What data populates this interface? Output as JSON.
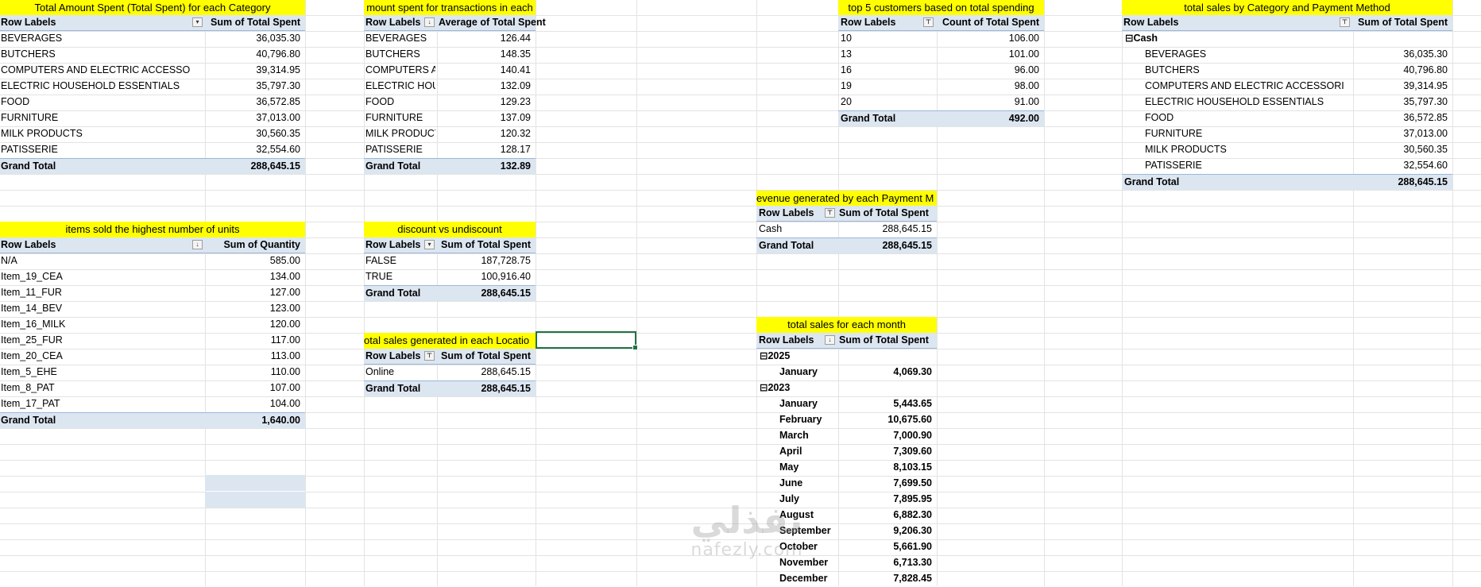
{
  "pivots": {
    "category": {
      "title": "Total Amount Spent (Total Spent) for each Category",
      "header": [
        "Row Labels",
        "Sum of Total Spent"
      ],
      "rows": [
        [
          "BEVERAGES",
          "36,035.30"
        ],
        [
          "BUTCHERS",
          "40,796.80"
        ],
        [
          "COMPUTERS AND ELECTRIC ACCESSORIES",
          "39,314.95"
        ],
        [
          "ELECTRIC HOUSEHOLD ESSENTIALS",
          "35,797.30"
        ],
        [
          "FOOD",
          "36,572.85"
        ],
        [
          "FURNITURE",
          "37,013.00"
        ],
        [
          "MILK PRODUCTS",
          "30,560.35"
        ],
        [
          "PATISSERIE",
          "32,554.60"
        ]
      ],
      "total": [
        "Grand Total",
        "288,645.15"
      ]
    },
    "average": {
      "title": "mount spent for transactions in each",
      "header": [
        "Row Labels",
        "Average of Total Spent"
      ],
      "rows": [
        [
          "BEVERAGES",
          "126.44"
        ],
        [
          "BUTCHERS",
          "148.35"
        ],
        [
          "COMPUTERS AND ELECTRIC ACCESSORIES",
          "140.41"
        ],
        [
          "ELECTRIC HOUSEHOLD ESSENTIALS",
          "132.09"
        ],
        [
          "FOOD",
          "129.23"
        ],
        [
          "FURNITURE",
          "137.09"
        ],
        [
          "MILK PRODUCTS",
          "120.32"
        ],
        [
          "PATISSERIE",
          "128.17"
        ]
      ],
      "total": [
        "Grand Total",
        "132.89"
      ]
    },
    "customers": {
      "title": "top 5 customers based on total spending",
      "header": [
        "Row Labels",
        "Count of Total Spent"
      ],
      "rows": [
        [
          "10",
          "106.00"
        ],
        [
          "13",
          "101.00"
        ],
        [
          "16",
          "96.00"
        ],
        [
          "19",
          "98.00"
        ],
        [
          "20",
          "91.00"
        ]
      ],
      "total": [
        "Grand Total",
        "492.00"
      ]
    },
    "category_payment": {
      "title": "total sales by Category and Payment Method",
      "header": [
        "Row Labels",
        "Sum of Total Spent"
      ],
      "group": "Cash",
      "rows": [
        [
          "BEVERAGES",
          "36,035.30"
        ],
        [
          "BUTCHERS",
          "40,796.80"
        ],
        [
          "COMPUTERS AND ELECTRIC ACCESSORIES",
          "39,314.95"
        ],
        [
          "ELECTRIC HOUSEHOLD ESSENTIALS",
          "35,797.30"
        ],
        [
          "FOOD",
          "36,572.85"
        ],
        [
          "FURNITURE",
          "37,013.00"
        ],
        [
          "MILK PRODUCTS",
          "30,560.35"
        ],
        [
          "PATISSERIE",
          "32,554.60"
        ]
      ],
      "total": [
        "Grand Total",
        "288,645.15"
      ]
    },
    "payment": {
      "title": "evenue generated by each Payment M",
      "header": [
        "Row Labels",
        "Sum of Total Spent"
      ],
      "rows": [
        [
          "Cash",
          "288,645.15"
        ]
      ],
      "total": [
        "Grand Total",
        "288,645.15"
      ]
    },
    "items": {
      "title": "items sold the highest number of units",
      "header": [
        "Row Labels",
        "Sum of Quantity"
      ],
      "rows": [
        [
          "N/A",
          "585.00"
        ],
        [
          "Item_19_CEA",
          "134.00"
        ],
        [
          "Item_11_FUR",
          "127.00"
        ],
        [
          "Item_14_BEV",
          "123.00"
        ],
        [
          "Item_16_MILK",
          "120.00"
        ],
        [
          "Item_25_FUR",
          "117.00"
        ],
        [
          "Item_20_CEA",
          "113.00"
        ],
        [
          "Item_5_EHE",
          "110.00"
        ],
        [
          "Item_8_PAT",
          "107.00"
        ],
        [
          "Item_17_PAT",
          "104.00"
        ]
      ],
      "total": [
        "Grand Total",
        "1,640.00"
      ]
    },
    "discount": {
      "title": "discount vs undiscount",
      "header": [
        "Row Labels",
        "Sum of Total Spent"
      ],
      "rows": [
        [
          "FALSE",
          "187,728.75"
        ],
        [
          "TRUE",
          "100,916.40"
        ]
      ],
      "total": [
        "Grand Total",
        "288,645.15"
      ]
    },
    "location": {
      "title": "otal sales generated in each Locatio",
      "header": [
        "Row Labels",
        "Sum of Total Spent"
      ],
      "rows": [
        [
          "Online",
          "288,645.15"
        ]
      ],
      "total": [
        "Grand Total",
        "288,645.15"
      ]
    },
    "monthly": {
      "title": "total sales for each month",
      "header": [
        "Row Labels",
        "Sum of Total Spent"
      ],
      "year1": "2025",
      "year1_rows": [
        [
          "January",
          "4,069.30"
        ]
      ],
      "year2": "2023",
      "year2_rows": [
        [
          "January",
          "5,443.65"
        ],
        [
          "February",
          "10,675.60"
        ],
        [
          "March",
          "7,000.90"
        ],
        [
          "April",
          "7,309.60"
        ],
        [
          "May",
          "8,103.15"
        ],
        [
          "June",
          "7,699.50"
        ],
        [
          "July",
          "7,895.95"
        ],
        [
          "August",
          "6,882.30"
        ],
        [
          "September",
          "9,206.30"
        ],
        [
          "October",
          "5,661.90"
        ],
        [
          "November",
          "6,713.30"
        ],
        [
          "December",
          "7,828.45"
        ]
      ]
    }
  },
  "watermark": {
    "line1": "نفذلي",
    "line2": "nafezly.com"
  },
  "colors": {
    "title_fill": "#ffff00",
    "header_fill": "#dce6f1",
    "selection": "#217346"
  }
}
